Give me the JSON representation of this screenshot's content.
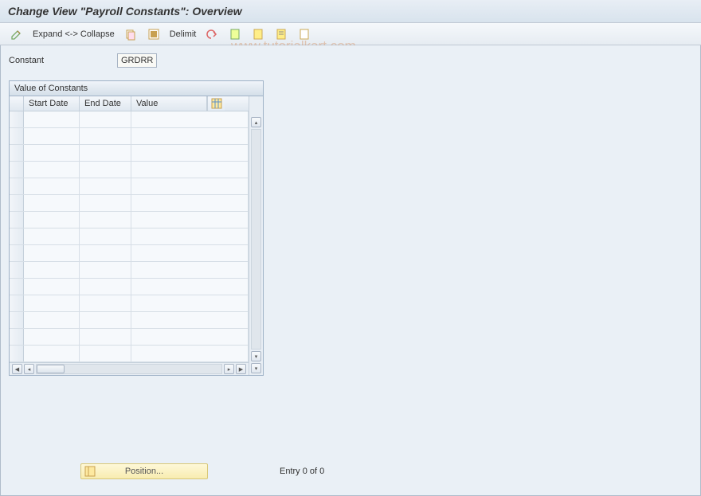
{
  "title": "Change View \"Payroll Constants\": Overview",
  "toolbar": {
    "expand_collapse_label": "Expand <-> Collapse",
    "delimit_label": "Delimit"
  },
  "constant": {
    "label": "Constant",
    "value": "GRDRR"
  },
  "panel": {
    "title": "Value of Constants",
    "columns": {
      "start": "Start Date",
      "end": "End Date",
      "value": "Value"
    },
    "rows": [
      {
        "start": "",
        "end": "",
        "value": ""
      },
      {
        "start": "",
        "end": "",
        "value": ""
      },
      {
        "start": "",
        "end": "",
        "value": ""
      },
      {
        "start": "",
        "end": "",
        "value": ""
      },
      {
        "start": "",
        "end": "",
        "value": ""
      },
      {
        "start": "",
        "end": "",
        "value": ""
      },
      {
        "start": "",
        "end": "",
        "value": ""
      },
      {
        "start": "",
        "end": "",
        "value": ""
      },
      {
        "start": "",
        "end": "",
        "value": ""
      },
      {
        "start": "",
        "end": "",
        "value": ""
      },
      {
        "start": "",
        "end": "",
        "value": ""
      },
      {
        "start": "",
        "end": "",
        "value": ""
      },
      {
        "start": "",
        "end": "",
        "value": ""
      },
      {
        "start": "",
        "end": "",
        "value": ""
      },
      {
        "start": "",
        "end": "",
        "value": ""
      }
    ]
  },
  "position_label": "Position...",
  "entry_status": "Entry 0 of 0",
  "watermark": "www.tutorialkart.com"
}
